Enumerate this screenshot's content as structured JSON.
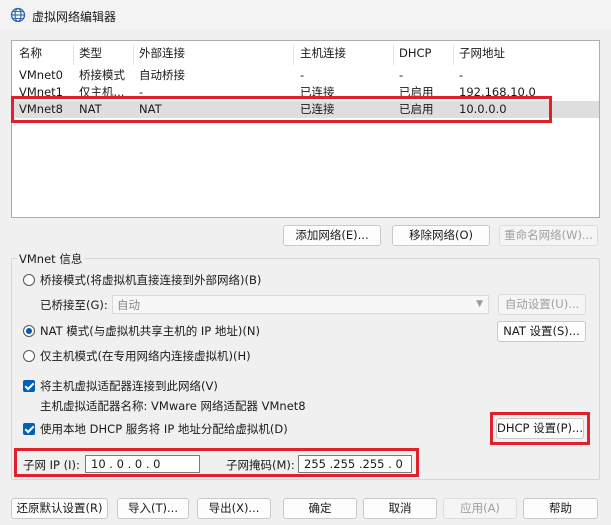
{
  "window": {
    "title": "虚拟网络编辑器",
    "icon": "globe-icon"
  },
  "network_table": {
    "columns": [
      "名称",
      "类型",
      "外部连接",
      "主机连接",
      "DHCP",
      "子网地址"
    ],
    "rows": [
      [
        "VMnet0",
        "桥接模式",
        "自动桥接",
        "-",
        "-",
        "-"
      ],
      [
        "VMnet1",
        "仅主机...",
        "-",
        "已连接",
        "已启用",
        "192.168.10.0"
      ],
      [
        "VMnet8",
        "NAT",
        "NAT",
        "已连接",
        "已启用",
        "10.0.0.0"
      ]
    ],
    "selected_row": 2
  },
  "list_buttons": {
    "add": "添加网络(E)...",
    "remove": "移除网络(O)",
    "rename": "重命名网络(W)..."
  },
  "vmnet_info": {
    "group_label": "VMnet 信息",
    "bridge_radio": "桥接模式(将虚拟机直接连接到外部网络)(B)",
    "bridged_to_label": "已桥接至(G):",
    "bridged_to_value": "自动",
    "auto_settings": "自动设置(U)...",
    "nat_radio": "NAT 模式(与虚拟机共享主机的 IP 地址)(N)",
    "nat_settings": "NAT 设置(S)...",
    "host_only_radio": "仅主机模式(在专用网络内连接虚拟机)(H)",
    "connect_adapter_check": "将主机虚拟适配器连接到此网络(V)",
    "adapter_name_text": "主机虚拟适配器名称: VMware 网络适配器 VMnet8",
    "dhcp_check": "使用本地 DHCP 服务将 IP 地址分配给虚拟机(D)",
    "dhcp_settings": "DHCP 设置(P)...",
    "subnet_ip_label": "子网 IP (I):",
    "subnet_ip_value": "10 . 0 . 0 . 0",
    "subnet_mask_label": "子网掩码(M):",
    "subnet_mask_value": "255 .255 .255 . 0",
    "selected_mode": "nat",
    "connect_adapter_checked": true,
    "dhcp_checked": true
  },
  "footer_buttons": {
    "restore": "还原默认设置(R)",
    "import": "导入(T)...",
    "export": "导出(X)...",
    "ok": "确定",
    "cancel": "取消",
    "apply": "应用(A)",
    "help": "帮助"
  },
  "colors": {
    "highlight": "#e0202a",
    "accent": "#005fb8",
    "selected_row": "#dedede"
  }
}
